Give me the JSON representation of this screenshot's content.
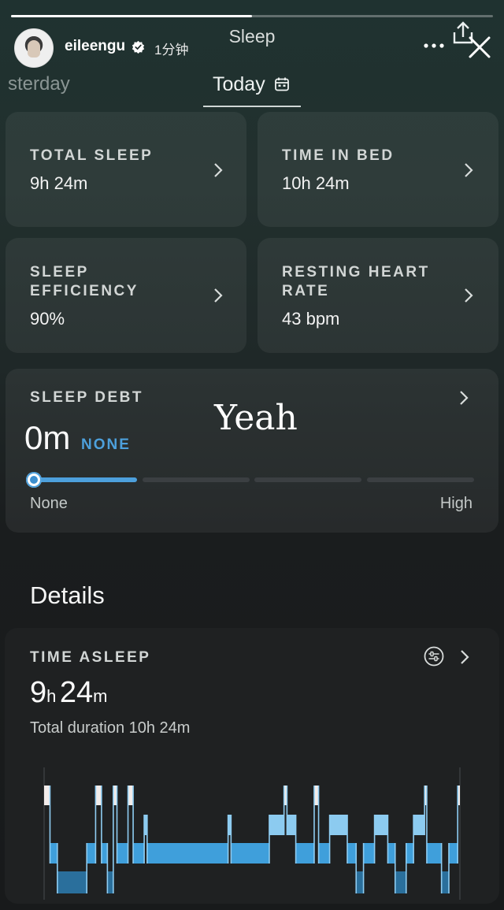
{
  "story": {
    "username": "eileengu",
    "time": "1分钟",
    "progress": 0.5
  },
  "header": {
    "title": "Sleep"
  },
  "date_nav": {
    "previous": "sterday",
    "current": "Today"
  },
  "metrics": [
    {
      "title": "TOTAL SLEEP",
      "value": "9h 24m"
    },
    {
      "title": "TIME IN BED",
      "value": "10h 24m"
    },
    {
      "title": "SLEEP\nEFFICIENCY",
      "value": "90%"
    },
    {
      "title": "RESTING HEART\nRATE",
      "value": "43 bpm"
    }
  ],
  "sleep_debt": {
    "title": "SLEEP DEBT",
    "value": "0m",
    "level": "NONE",
    "level_index": 0,
    "scale_min": "None",
    "scale_max": "High"
  },
  "overlay_text": "Yeah",
  "details": {
    "title": "Details",
    "time_asleep": {
      "title": "TIME ASLEEP",
      "hours": "9",
      "hours_unit": "h",
      "minutes": "24",
      "minutes_unit": "m",
      "total_duration": "Total duration 10h 24m"
    }
  },
  "colors": {
    "accent": "#4da0dc",
    "awake": "#f2ecea",
    "rem": "#8ccbf0",
    "light": "#3f9fdb",
    "deep": "#2a6f9c"
  },
  "chart_data": {
    "type": "hypnogram",
    "stages": [
      "Awake",
      "REM",
      "Light",
      "Deep"
    ],
    "stage_order_top_to_bottom": [
      "Awake",
      "REM",
      "Light",
      "Deep"
    ],
    "total_duration_min": 624,
    "segments": [
      {
        "stage": "Awake",
        "dur": 8
      },
      {
        "stage": "Light",
        "dur": 10
      },
      {
        "stage": "Deep",
        "dur": 40
      },
      {
        "stage": "Light",
        "dur": 12
      },
      {
        "stage": "Awake",
        "dur": 8
      },
      {
        "stage": "Light",
        "dur": 8
      },
      {
        "stage": "Deep",
        "dur": 8
      },
      {
        "stage": "Awake",
        "dur": 5
      },
      {
        "stage": "Light",
        "dur": 15
      },
      {
        "stage": "Awake",
        "dur": 7
      },
      {
        "stage": "Light",
        "dur": 15
      },
      {
        "stage": "REM",
        "dur": 4
      },
      {
        "stage": "Light",
        "dur": 110
      },
      {
        "stage": "REM",
        "dur": 4
      },
      {
        "stage": "Light",
        "dur": 52
      },
      {
        "stage": "REM",
        "dur": 20
      },
      {
        "stage": "Awake",
        "dur": 4
      },
      {
        "stage": "REM",
        "dur": 12
      },
      {
        "stage": "Light",
        "dur": 25
      },
      {
        "stage": "Awake",
        "dur": 6
      },
      {
        "stage": "Light",
        "dur": 15
      },
      {
        "stage": "REM",
        "dur": 24
      },
      {
        "stage": "Light",
        "dur": 12
      },
      {
        "stage": "Deep",
        "dur": 10
      },
      {
        "stage": "Light",
        "dur": 15
      },
      {
        "stage": "REM",
        "dur": 18
      },
      {
        "stage": "Light",
        "dur": 10
      },
      {
        "stage": "Deep",
        "dur": 15
      },
      {
        "stage": "Light",
        "dur": 10
      },
      {
        "stage": "REM",
        "dur": 15
      },
      {
        "stage": "Awake",
        "dur": 3
      },
      {
        "stage": "Light",
        "dur": 20
      },
      {
        "stage": "Deep",
        "dur": 10
      },
      {
        "stage": "Light",
        "dur": 12
      },
      {
        "stage": "Awake",
        "dur": 3
      }
    ]
  }
}
